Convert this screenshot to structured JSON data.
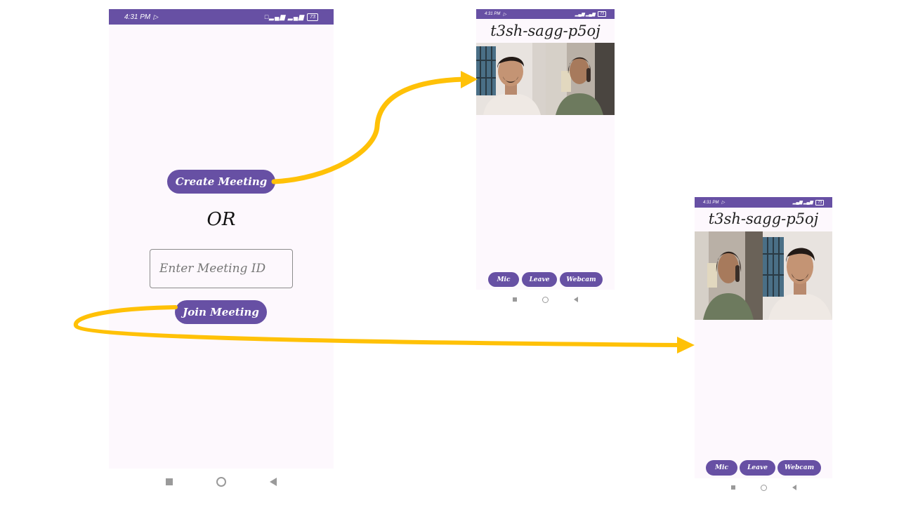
{
  "colors": {
    "accent": "#6750a4",
    "arrow": "#ffc107",
    "phone_bg": "#fdf8fd"
  },
  "home_screen": {
    "status": {
      "time": "4:31 PM",
      "battery": "73"
    },
    "create_button": "Create Meeting",
    "or_label": "OR",
    "meeting_id_placeholder": "Enter Meeting ID",
    "join_button": "Join Meeting"
  },
  "meeting_screen_created": {
    "status": {
      "time": "4:31 PM",
      "battery": "73"
    },
    "meeting_id": "t3sh-sagg-p5oj",
    "controls": {
      "mic": "Mic",
      "leave": "Leave",
      "webcam": "Webcam"
    }
  },
  "meeting_screen_joined": {
    "status": {
      "time": "4:31 PM",
      "battery": "73"
    },
    "meeting_id": "t3sh-sagg-p5oj",
    "controls": {
      "mic": "Mic",
      "leave": "Leave",
      "webcam": "Webcam"
    }
  },
  "icons": [
    "play-store-icon",
    "signal-icon",
    "battery-icon",
    "recent-apps-icon",
    "home-icon",
    "back-icon",
    "video-feed-icon"
  ]
}
